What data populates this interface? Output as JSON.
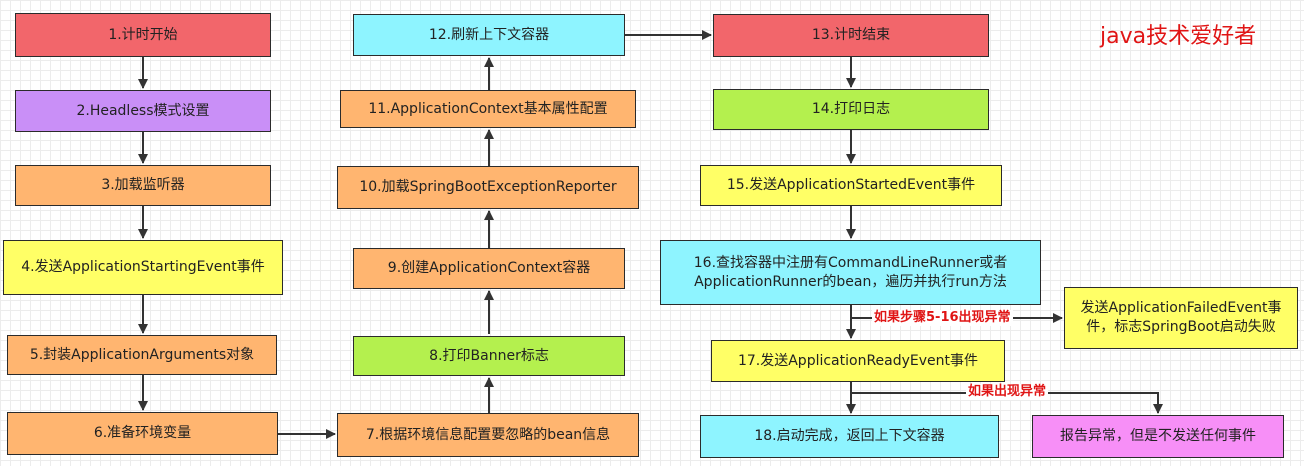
{
  "watermark": "java技术爱好者",
  "steps": {
    "s1": "1.计时开始",
    "s2": "2.Headless模式设置",
    "s3": "3.加载监听器",
    "s4": "4.发送ApplicationStartingEvent事件",
    "s5": "5.封装ApplicationArguments对象",
    "s6": "6.准备环境变量",
    "s7": "7.根据环境信息配置要忽略的bean信息",
    "s8": "8.打印Banner标志",
    "s9": "9.创建ApplicationContext容器",
    "s10": "10.加载SpringBootExceptionReporter",
    "s11": "11.ApplicationContext基本属性配置",
    "s12": "12.刷新上下文容器",
    "s13": "13.计时结束",
    "s14": "14.打印日志",
    "s15": "15.发送ApplicationStartedEvent事件",
    "s16_line1": "16.查找容器中注册有CommandLineRunner或者",
    "s16_line2": "ApplicationRunner的bean，遍历并执行run方法",
    "s17": "17.发送ApplicationReadyEvent事件",
    "s18": "18.启动完成，返回上下文容器",
    "failed_line1": "发送ApplicationFailedEvent事",
    "failed_line2": "件，标志SpringBoot启动失败",
    "report": "报告异常，但是不发送任何事件"
  },
  "labels": {
    "exception_5_16": "如果步骤5-16出现异常",
    "exception": "如果出现异常"
  },
  "colors": {
    "red": "#f2666b",
    "purple": "#c98ff7",
    "orange": "#ffb570",
    "yellow": "#ffff66",
    "cyan": "#8ef4ff",
    "green": "#b4f04e",
    "pink": "#f78ff7",
    "label_red": "#e01515"
  }
}
